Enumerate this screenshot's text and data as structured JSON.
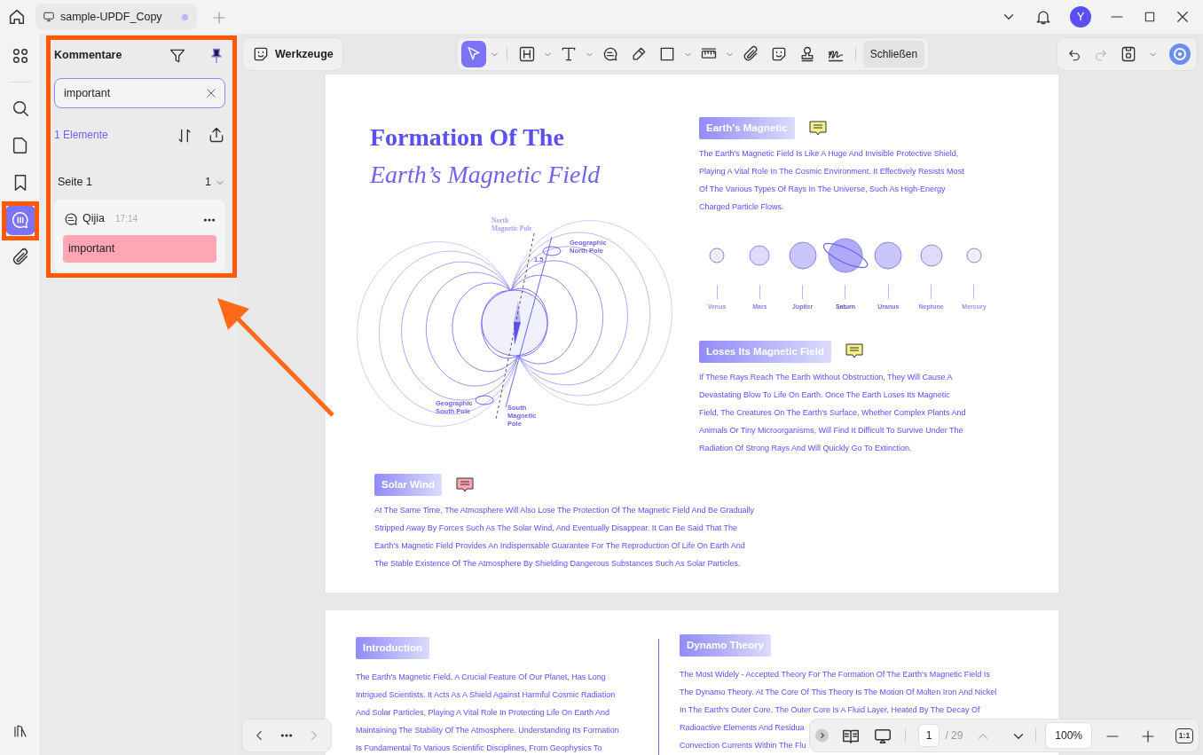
{
  "title_bar": {
    "tab": {
      "title": "sample-UPDF_Copy",
      "unsaved": true
    },
    "avatar": "Y"
  },
  "rail": {
    "items": [
      {
        "kind": "apps",
        "selected": false
      },
      {
        "kind": "search",
        "selected": false
      },
      {
        "kind": "pages",
        "selected": false
      },
      {
        "kind": "bookmark",
        "selected": false
      },
      {
        "kind": "comments",
        "selected": true
      },
      {
        "kind": "attachment",
        "selected": false
      }
    ]
  },
  "comments_panel": {
    "title": "Kommentare",
    "pinned": true,
    "search": {
      "value": "important"
    },
    "count": "1 Elemente",
    "groups": [
      {
        "label": "Seite 1",
        "count": "1",
        "expanded": true,
        "comments": [
          {
            "author": "Qijia",
            "time": "17:14",
            "text": "important",
            "color": "#ffa6b5"
          }
        ]
      }
    ]
  },
  "toolbar": {
    "tools_button": "Werkzeuge",
    "tools": [
      {
        "kind": "select",
        "selected": true,
        "dropdown": true
      },
      {
        "kind": "heading",
        "selected": false,
        "dropdown": true
      },
      {
        "kind": "text",
        "selected": false,
        "dropdown": true
      },
      {
        "kind": "comment",
        "selected": false,
        "dropdown": false
      },
      {
        "kind": "pencil",
        "selected": false,
        "dropdown": false
      },
      {
        "kind": "shape",
        "selected": false,
        "dropdown": true
      },
      {
        "kind": "measure",
        "selected": false,
        "dropdown": true
      },
      {
        "kind": "attachment",
        "selected": false,
        "dropdown": false
      },
      {
        "kind": "sticker",
        "selected": false,
        "dropdown": false
      },
      {
        "kind": "stamp",
        "selected": false,
        "dropdown": false
      },
      {
        "kind": "signature",
        "selected": false,
        "dropdown": false
      }
    ],
    "close_button": "Schließen"
  },
  "page_1": {
    "title": "Formation Of The",
    "subtitle": "Earth’s Magnetic Field",
    "diagram_labels": [
      {
        "lines": [
          "North",
          "Magnetic Pole"
        ]
      },
      {
        "lines": [
          "Geographic",
          "North Pole"
        ]
      },
      {
        "lines": [
          "1.5"
        ]
      },
      {
        "lines": [
          "Geographic",
          "South Pole"
        ]
      },
      {
        "lines": [
          "South",
          "Magnetic",
          "Pole"
        ]
      }
    ],
    "sections": [
      {
        "heading": "Earth's Magnetic",
        "color": "#f7f08a",
        "lines": [
          "The Earth's Magnetic Field Is Like A Huge And Invisible Protective Shield,",
          "Playing A Vital Role In The Cosmic Environment. It Effectively Resists Most",
          "Of The Various Types Of Rays In The Universe, Such As High-Energy",
          "Charged Particle Flows."
        ]
      },
      {
        "heading": "Loses Its Magnetic Field",
        "color": "#f7f08a",
        "lines": [
          "If These Rays Reach The Earth Without Obstruction, They Will Cause A",
          "Devastating Blow To Life On Earth. Once The Earth Loses Its Magnetic",
          "Field, The Creatures On The Earth's Surface, Whether Complex Plants And",
          "Animals Or Tiny Microorganisms, Will Find It Difficult To Survive Under The",
          "Radiation Of Strong Rays And Will Quickly Go To Extinction."
        ]
      },
      {
        "heading": "Solar Wind",
        "color": "#ffa6b5",
        "lines": [
          "At The Same Time, The Atmosphere Will Also Lose The Protection Of The Magnetic Field And Be Gradually",
          "Stripped Away By Forces Such As The Solar Wind, And Eventually Disappear. It Can Be Said That The",
          "Earth's Magnetic Field Provides An Indispensable Guarantee For The Reproduction Of Life On Earth And",
          "The Stable Existence Of The Atmosphere By Shielding Dangerous Substances Such As Solar Particles."
        ]
      }
    ],
    "planets": [
      {
        "name": "Venus",
        "kind": "plain"
      },
      {
        "name": "Mars",
        "kind": "plain"
      },
      {
        "name": "Jupiter",
        "kind": "plain"
      },
      {
        "name": "Saturn",
        "kind": "ringed"
      },
      {
        "name": "Uranus",
        "kind": "plain"
      },
      {
        "name": "Neptune",
        "kind": "plain"
      },
      {
        "name": "Mercury",
        "kind": "plain"
      }
    ]
  },
  "page_2": {
    "sections": [
      {
        "heading": "Introduction",
        "lines": [
          "The Earth's Magnetic Field, A Crucial Feature Of Our Planet, Has Long",
          "Intrigued Scientists. It Acts As A Shield Against Harmful Cosmic Radiation",
          "And Solar Particles, Playing A Vital Role In Protecting Life On Earth And",
          "Maintaining The Stability Of The Atmosphere. Understanding Its Formation",
          "Is Fundamental To Various Scientific Disciplines, From Geophysics To"
        ]
      },
      {
        "heading": "Dynamo Theory",
        "lines": [
          "The Most Widely - Accepted Theory For The Formation Of The Earth's Magnetic Field Is",
          "The Dynamo Theory. At The Core Of This Theory Is The Motion Of Molten Iron And Nickel",
          "In The Earth's Outer Core. The Outer Core Is A Fluid Layer, Heated By The Decay Of",
          "Radioactive Elements And Residua",
          "Convection Currents Within The Flu"
        ]
      }
    ]
  },
  "bottom_bar": {
    "page_input": "1",
    "page_total": "/ 29",
    "zoom": "100%",
    "fit_button": "1:1"
  }
}
